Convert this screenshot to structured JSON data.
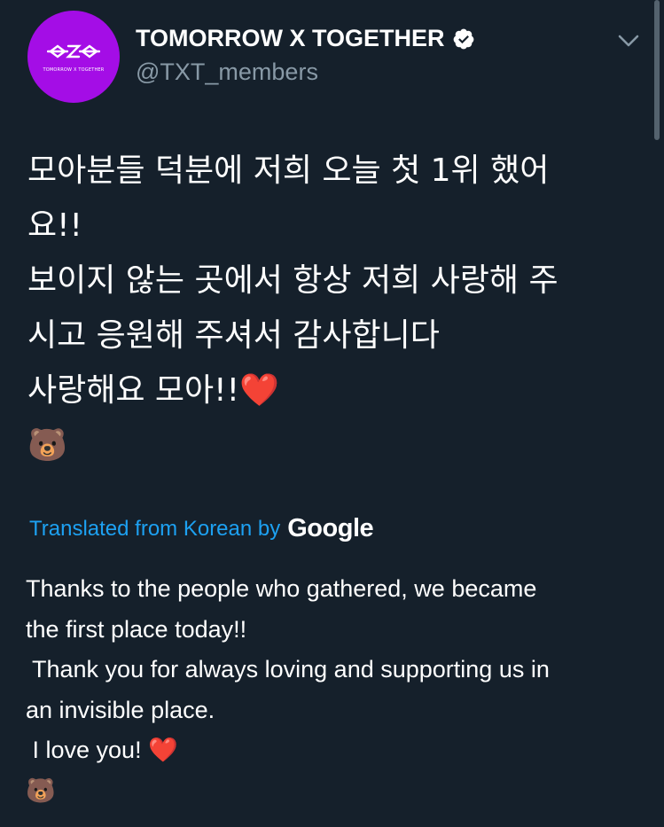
{
  "account": {
    "display_name": "TOMORROW X TOGETHER",
    "handle": "@TXT_members",
    "avatar_text": "TOMORROW X TOGETHER",
    "avatar_color": "#a40de6"
  },
  "icons": {
    "verified": "verified-badge-icon",
    "more": "chevron-down-icon",
    "heart": "red-heart-emoji",
    "bear": "bear-face-emoji"
  },
  "tweet": {
    "korean_lines": [
      "모아분들 덕분에 저희 오늘 첫 1위 했어",
      "요!!",
      "보이지 않는 곳에서 항상 저희 사랑해 주",
      "시고 응원해 주셔서 감사합니다",
      "사랑해요 모아!!",
      ""
    ],
    "translation_label": "Translated from Korean by",
    "translation_provider": "Google",
    "english_lines": [
      "Thanks to the people who gathered, we became",
      "the first place today!!",
      " Thank you for always loving and supporting us in",
      "an invisible place.",
      " I love you! ",
      ""
    ],
    "heart_emoji": "❤️",
    "bear_emoji": "🐻"
  },
  "colors": {
    "background": "#15202b",
    "text": "#ffffff",
    "secondary_text": "#8899a6",
    "link": "#1da1f2",
    "heart": "#e0163a"
  }
}
